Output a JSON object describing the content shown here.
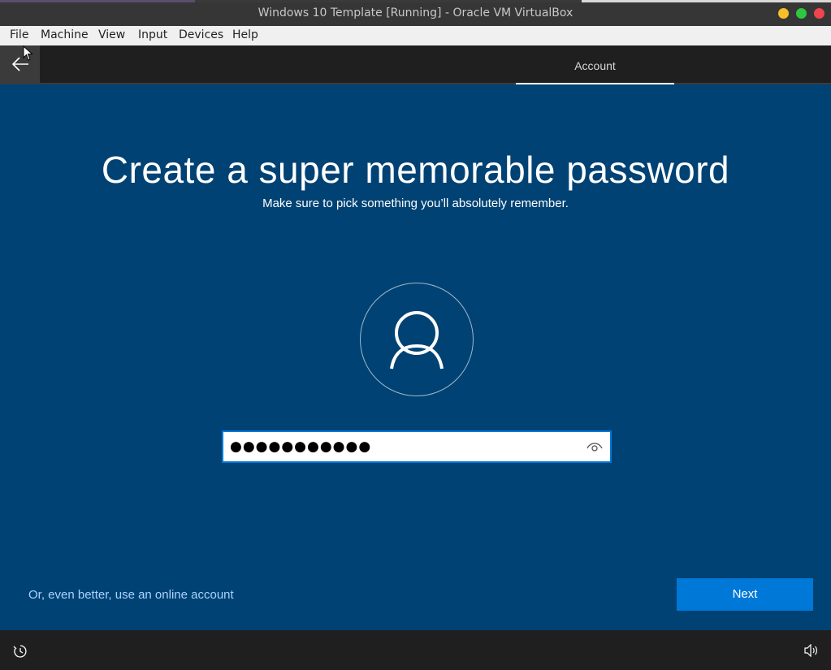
{
  "window": {
    "title": "Windows 10 Template [Running] - Oracle VM VirtualBox"
  },
  "menu": {
    "items": [
      "File",
      "Machine",
      "View",
      "Input",
      "Devices",
      "Help"
    ]
  },
  "oobe": {
    "back_icon": "arrow-left-icon",
    "tab_label": "Account",
    "heading": "Create a super memorable password",
    "subheading": "Make sure to pick something you’ll absolutely remember.",
    "password_value": "●●●●●●●●●●●",
    "reveal_icon": "eye-icon",
    "online_account_link": "Or, even better, use an online account",
    "next_button": "Next",
    "ease_of_access_icon": "ease-of-access-icon",
    "volume_icon": "volume-icon"
  },
  "colors": {
    "background": "#004274",
    "accent": "#0078d7",
    "link": "#a8d4ff"
  }
}
